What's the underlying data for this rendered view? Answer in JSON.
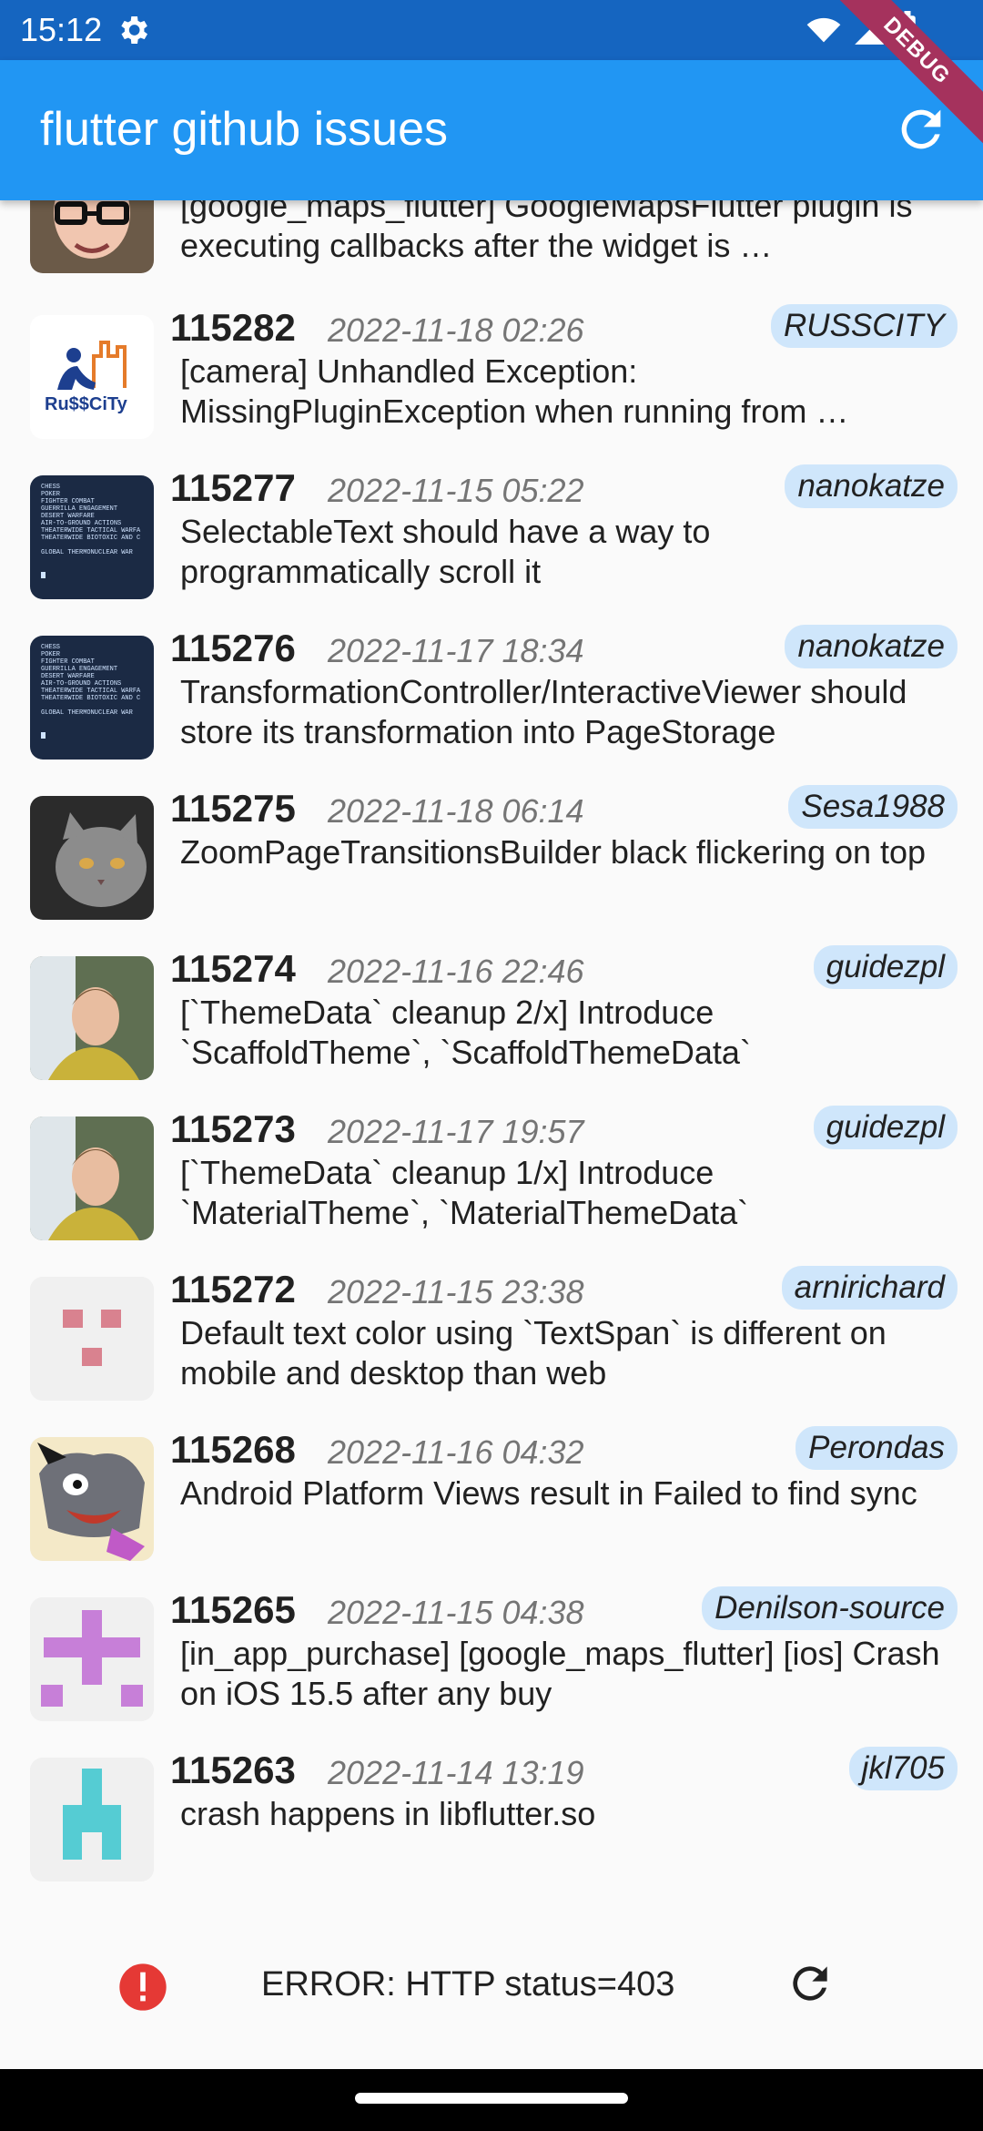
{
  "status_bar": {
    "time": "15:12"
  },
  "debug_banner": {
    "label": "DEBUG"
  },
  "app_bar": {
    "title": "flutter github issues"
  },
  "partial_item": {
    "title": "[google_maps_flutter] GoogleMapsFlutter plugin is executing callbacks after the widget is …",
    "avatar": "person-glasses-avatar"
  },
  "issues": [
    {
      "number": "115282",
      "date": "2022-11-18 02:26",
      "user": "RUSSCITY",
      "title": "[camera] Unhandled Exception: MissingPluginException when running from …",
      "avatar": "russcity-logo"
    },
    {
      "number": "115277",
      "date": "2022-11-15 05:22",
      "user": "nanokatze",
      "title": "SelectableText should have a way to programmatically scroll it",
      "avatar": "terminal-screen"
    },
    {
      "number": "115276",
      "date": "2022-11-17 18:34",
      "user": "nanokatze",
      "title": "TransformationController/InteractiveViewer should store its transformation into PageStorage",
      "avatar": "terminal-screen"
    },
    {
      "number": "115275",
      "date": "2022-11-18 06:14",
      "user": "Sesa1988",
      "title": "ZoomPageTransitionsBuilder black flickering on top",
      "avatar": "cat-photo"
    },
    {
      "number": "115274",
      "date": "2022-11-16 22:46",
      "user": "guidezpl",
      "title": "[`ThemeData` cleanup 2/x] Introduce `ScaffoldTheme`, `ScaffoldThemeData`",
      "avatar": "person-waterfall"
    },
    {
      "number": "115273",
      "date": "2022-11-17 19:57",
      "user": "guidezpl",
      "title": "[`ThemeData` cleanup 1/x] Introduce `MaterialTheme`, `MaterialThemeData`",
      "avatar": "person-waterfall"
    },
    {
      "number": "115272",
      "date": "2022-11-15 23:38",
      "user": "arnirichard",
      "title": "Default text color using `TextSpan` is different on mobile and desktop than web",
      "avatar": "identicon-pink"
    },
    {
      "number": "115268",
      "date": "2022-11-16 04:32",
      "user": "Perondas",
      "title": "Android Platform Views result in Failed to find sync",
      "avatar": "cartoon-wolf"
    },
    {
      "number": "115265",
      "date": "2022-11-15 04:38",
      "user": "Denilson-source",
      "title": "[in_app_purchase] [google_maps_flutter] [ios] Crash on iOS 15.5 after any buy",
      "avatar": "identicon-purple"
    },
    {
      "number": "115263",
      "date": "2022-11-14 13:19",
      "user": "jkl705",
      "title": "crash happens in libflutter.so",
      "avatar": "identicon-cyan"
    }
  ],
  "error": {
    "message": "ERROR: HTTP status=403"
  },
  "colors": {
    "app_bar": "#2196f3",
    "status_bar": "#1565c0",
    "chip_background": "#cfe6fb",
    "error_icon": "#e53935",
    "debug_banner": "#a5325d"
  }
}
